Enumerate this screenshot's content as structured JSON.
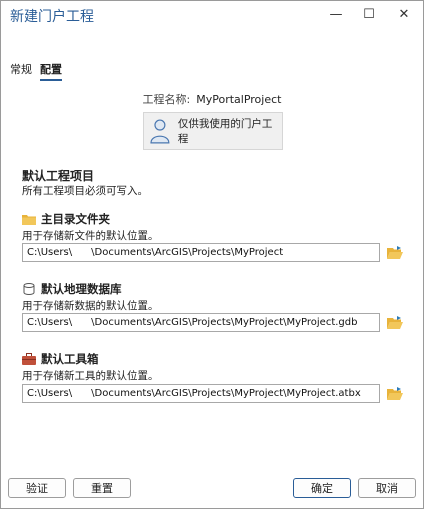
{
  "window": {
    "title": "新建门户工程",
    "minimize_glyph": "—",
    "maximize_glyph": "☐",
    "close_glyph": "✕"
  },
  "tabs": [
    {
      "label": "常规",
      "active": false
    },
    {
      "label": "配置",
      "active": true
    }
  ],
  "project": {
    "name_label": "工程名称:",
    "name_value": "MyPortalProject",
    "share_label": "仅供我使用的门户工程"
  },
  "defaults": {
    "title": "默认工程项目",
    "description": "所有工程项目必须可写入。"
  },
  "groups": [
    {
      "title": "主目录文件夹",
      "description": "用于存储新文件的默认位置。",
      "path": "C:\\Users\\      \\Documents\\ArcGIS\\Projects\\MyProject",
      "icon": "folder-icon"
    },
    {
      "title": "默认地理数据库",
      "description": "用于存储新数据的默认位置。",
      "path": "C:\\Users\\      \\Documents\\ArcGIS\\Projects\\MyProject\\MyProject.gdb",
      "icon": "database-icon"
    },
    {
      "title": "默认工具箱",
      "description": "用于存储新工具的默认位置。",
      "path": "C:\\Users\\      \\Documents\\ArcGIS\\Projects\\MyProject\\MyProject.atbx",
      "icon": "toolbox-icon"
    }
  ],
  "buttons": {
    "validate": "验证",
    "reset": "重置",
    "ok": "确定",
    "cancel": "取消"
  },
  "colors": {
    "title": "#2a5d97",
    "folder": "#e8b33a",
    "toolbox": "#c0503a"
  }
}
